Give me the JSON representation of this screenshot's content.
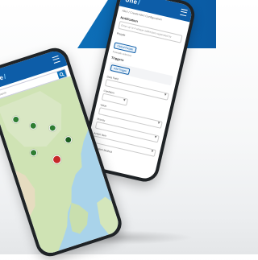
{
  "brand": {
    "name": "one",
    "slash": "/"
  },
  "form_phone": {
    "breadcrumb": "Alert / Create Alert Configuration",
    "notification_label": "Notification",
    "notification_placeholder": "Enter up to 4 unique addresses separated by",
    "people_label": "People",
    "people_chip": "Global People",
    "people_note": "0 people selected",
    "triggers_label": "Triggers",
    "trigger_chip": "Add Trigger",
    "fields": [
      {
        "label": "Data Field"
      },
      {
        "label": "Condition"
      },
      {
        "label": "Value"
      },
      {
        "label": "Priority"
      },
      {
        "label": "Action Item"
      },
      {
        "label": "Notification Method"
      }
    ]
  },
  "map_phone": {
    "search_placeholder": "Search"
  },
  "colors": {
    "brand_blue": "#0d5da8",
    "pin_green": "#2e7d32",
    "pin_red": "#c62828"
  },
  "icons": [
    "menu-icon",
    "search-icon",
    "map-pin-icon"
  ]
}
